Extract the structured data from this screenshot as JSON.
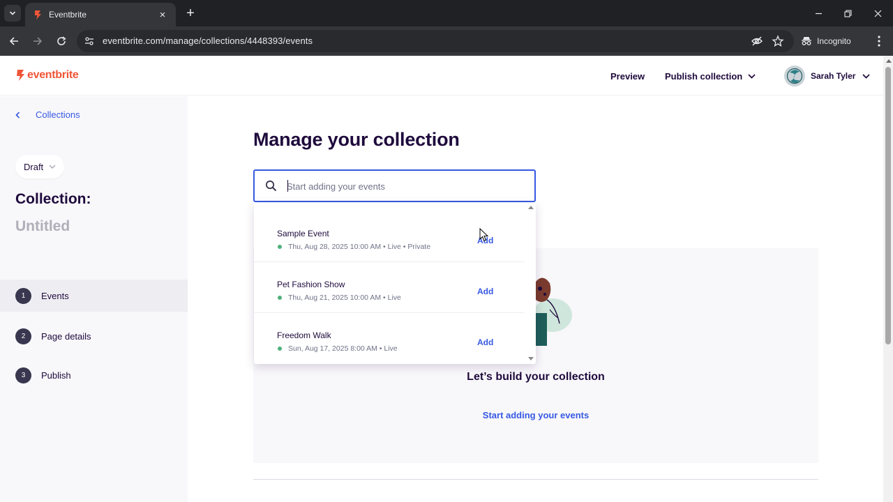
{
  "browser": {
    "tab_title": "Eventbrite",
    "url": "eventbrite.com/manage/collections/4448393/events",
    "incognito_label": "Incognito"
  },
  "header": {
    "logo_text": "eventbrite",
    "preview_label": "Preview",
    "publish_label": "Publish collection",
    "user_name": "Sarah Tyler"
  },
  "sidebar": {
    "back_label": "Collections",
    "status": "Draft",
    "collection_label": "Collection:",
    "collection_name": "Untitled",
    "steps": [
      {
        "number": "1",
        "label": "Events"
      },
      {
        "number": "2",
        "label": "Page details"
      },
      {
        "number": "3",
        "label": "Publish"
      }
    ]
  },
  "main": {
    "title": "Manage your collection",
    "search_placeholder": "Start adding your events",
    "empty_title": "Let’s build your collection",
    "empty_link": "Start adding your events"
  },
  "dropdown": {
    "add_label": "Add",
    "items": [
      {
        "name": "Sample Event",
        "meta": "Thu, Aug 28, 2025 10:00 AM • Live • Private"
      },
      {
        "name": "Pet Fashion Show",
        "meta": "Thu, Aug 21, 2025 10:00 AM • Live"
      },
      {
        "name": "Freedom Walk",
        "meta": "Sun, Aug 17, 2025 8:00 AM • Live"
      }
    ]
  },
  "colors": {
    "brand": "#f05537",
    "link": "#3659e3",
    "text": "#1e0a3c",
    "live_dot": "#4fb07b"
  }
}
